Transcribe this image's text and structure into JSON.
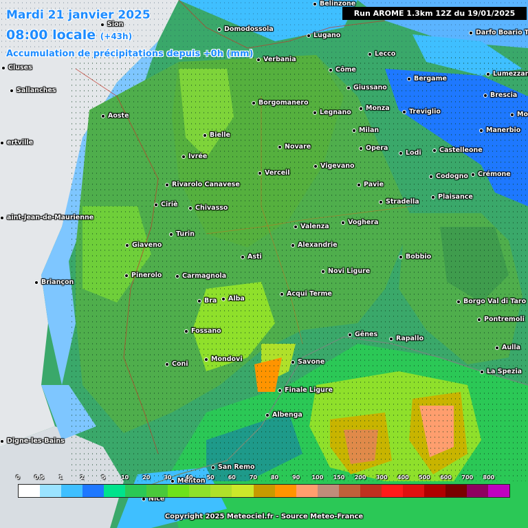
{
  "header": {
    "date_line": "Mardi 21 janvier 2025",
    "time_line": "08:00 locale",
    "time_offset": "(+43h)",
    "product_line": "Accumulation de précipitations depuis +0h (mm)",
    "run_label": "Run AROME 1.3km 12Z du 19/01/2025"
  },
  "cities": [
    {
      "name": "Belinzone"
    },
    {
      "name": "Sion"
    },
    {
      "name": "Domodossola"
    },
    {
      "name": "Lugano"
    },
    {
      "name": "Darfo Boario Term"
    },
    {
      "name": "Verbania"
    },
    {
      "name": "Lecco"
    },
    {
      "name": "Cluses"
    },
    {
      "name": "Côme"
    },
    {
      "name": "Lumezzane"
    },
    {
      "name": "Bergame"
    },
    {
      "name": "Giussano"
    },
    {
      "name": "Sallanches"
    },
    {
      "name": "Brescia"
    },
    {
      "name": "Borgomanero"
    },
    {
      "name": "Monza"
    },
    {
      "name": "Aoste"
    },
    {
      "name": "Legnano"
    },
    {
      "name": "Treviglio"
    },
    {
      "name": "Mon"
    },
    {
      "name": "Milan"
    },
    {
      "name": "Manerbio"
    },
    {
      "name": "Bielle"
    },
    {
      "name": "ertville"
    },
    {
      "name": "Novare"
    },
    {
      "name": "Opera"
    },
    {
      "name": "Castelleone"
    },
    {
      "name": "Lodi"
    },
    {
      "name": "Ivrée"
    },
    {
      "name": "Vigevano"
    },
    {
      "name": "Verceil"
    },
    {
      "name": "Crémone"
    },
    {
      "name": "Codogno"
    },
    {
      "name": "Rivarolo Canavese"
    },
    {
      "name": "Pavie"
    },
    {
      "name": "Plaisance"
    },
    {
      "name": "Stradella"
    },
    {
      "name": "Ciriè"
    },
    {
      "name": "Chivasso"
    },
    {
      "name": "aint-Jean-de-Maurienne"
    },
    {
      "name": "Voghera"
    },
    {
      "name": "Valenza"
    },
    {
      "name": "Turin"
    },
    {
      "name": "Giaveno"
    },
    {
      "name": "Alexandrie"
    },
    {
      "name": "Asti"
    },
    {
      "name": "Bobbio"
    },
    {
      "name": "Novi Ligure"
    },
    {
      "name": "Pinerolo"
    },
    {
      "name": "Carmagnola"
    },
    {
      "name": "Briançon"
    },
    {
      "name": "Acqui Terme"
    },
    {
      "name": "Alba"
    },
    {
      "name": "Bra"
    },
    {
      "name": "Borgo Val di Taro"
    },
    {
      "name": "Pontremoli"
    },
    {
      "name": "Fossano"
    },
    {
      "name": "Gênes"
    },
    {
      "name": "Rapallo"
    },
    {
      "name": "Aulla"
    },
    {
      "name": "Mondovi"
    },
    {
      "name": "Savone"
    },
    {
      "name": "Coni"
    },
    {
      "name": "La Spezia"
    },
    {
      "name": "Finale Ligure"
    },
    {
      "name": "Albenga"
    },
    {
      "name": "Digne-les-Bains"
    },
    {
      "name": "San Remo"
    },
    {
      "name": "Menton"
    },
    {
      "name": "Nice"
    }
  ],
  "legend": {
    "ticks": [
      "0",
      "0.5",
      "1",
      "2",
      "5",
      "10",
      "20",
      "30",
      "40",
      "50",
      "60",
      "70",
      "80",
      "90",
      "100",
      "150",
      "200",
      "300",
      "400",
      "500",
      "600",
      "700",
      "800"
    ],
    "colors": [
      "#ffffff",
      "#9be3ff",
      "#3fbfff",
      "#1e78ff",
      "#00e38c",
      "#2bc856",
      "#4ac93a",
      "#6ee21b",
      "#8fe02b",
      "#b0e02a",
      "#cce82a",
      "#c89a00",
      "#ff9400",
      "#ff9e6e",
      "#c08c7a",
      "#c0603a",
      "#c03020",
      "#ff1a1a",
      "#e01010",
      "#b00000",
      "#7a0000",
      "#900060",
      "#c000c0"
    ]
  },
  "copyright": "Copyright 2025 Meteociel.fr - Source Meteo-France"
}
